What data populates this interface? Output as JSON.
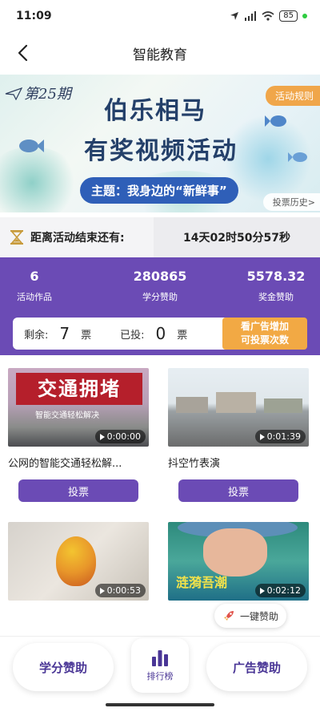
{
  "status_bar": {
    "time": "11:09",
    "battery": "85"
  },
  "nav": {
    "title": "智能教育"
  },
  "banner": {
    "issue": "第25期",
    "title_line1": "伯乐相马",
    "title_line2": "有奖视频活动",
    "theme": "主题：我身边的“新鲜事”",
    "rules_label": "活动规则",
    "history_label": "投票历史>"
  },
  "countdown": {
    "label": "距离活动结束还有:",
    "remaining": "14天02时50分57秒"
  },
  "stats": {
    "items": [
      {
        "value": "6",
        "label": "活动作品"
      },
      {
        "value": "280865",
        "label": "学分赞助"
      },
      {
        "value": "5578.32",
        "label": "奖金赞助"
      }
    ],
    "remaining_label": "剩余:",
    "remaining_value": "7",
    "cast_label": "已投:",
    "cast_value": "0",
    "unit": "票",
    "ad_button_line1": "看广告增加",
    "ad_button_line2": "可投票次数"
  },
  "videos": [
    {
      "title": "公网的智能交通轻松解...",
      "duration": "0:00:00",
      "thumb_text": "交通拥堵",
      "thumb_sub": "智能交通轻松解决",
      "vote_label": "投票"
    },
    {
      "title": "抖空竹表演",
      "duration": "0:01:39",
      "vote_label": "投票"
    },
    {
      "duration": "0:00:53"
    },
    {
      "duration": "0:02:12",
      "thumb_text": "涟漪吾潮"
    }
  ],
  "sponsor_pill": {
    "label": "一键赞助"
  },
  "bottom": {
    "credit_label": "学分赞助",
    "rank_label": "排行榜",
    "ad_label": "广告赞助"
  },
  "colors": {
    "primary": "#6b4bb5",
    "accent": "#f2a944"
  }
}
